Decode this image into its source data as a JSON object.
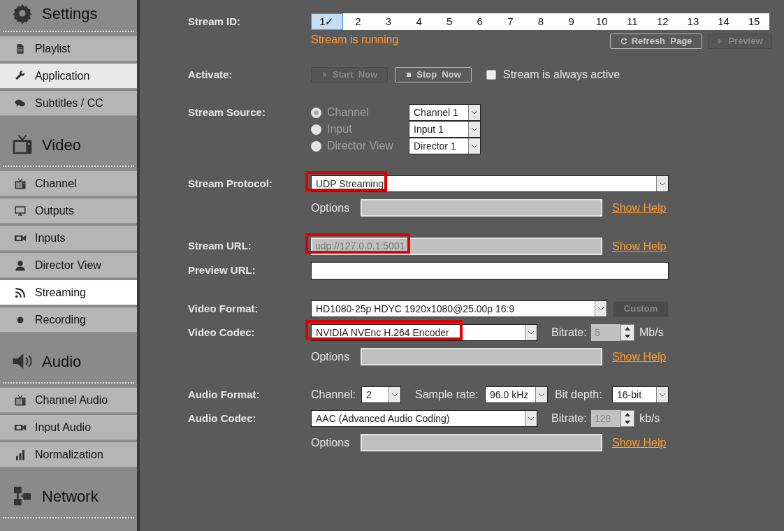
{
  "sidebar": {
    "sections": [
      {
        "title": "Settings",
        "kind": "gear",
        "items": [
          {
            "label": "Playlist",
            "kind": "document",
            "selected": false
          },
          {
            "label": "Application",
            "kind": "wrench",
            "selected": false,
            "hover": true
          },
          {
            "label": "Subtitles / CC",
            "kind": "speech",
            "selected": false
          }
        ]
      },
      {
        "title": "Video",
        "kind": "tv",
        "items": [
          {
            "label": "Channel",
            "kind": "tv",
            "selected": false
          },
          {
            "label": "Outputs",
            "kind": "monitor",
            "selected": false
          },
          {
            "label": "Inputs",
            "kind": "camera",
            "selected": false
          },
          {
            "label": "Director View",
            "kind": "person",
            "selected": false
          },
          {
            "label": "Streaming",
            "kind": "rss",
            "selected": true
          },
          {
            "label": "Recording",
            "kind": "dot",
            "selected": false
          }
        ]
      },
      {
        "title": "Audio",
        "kind": "speaker",
        "items": [
          {
            "label": "Channel Audio",
            "kind": "tv",
            "selected": false
          },
          {
            "label": "Input Audio",
            "kind": "camera",
            "selected": false
          },
          {
            "label": "Normalization",
            "kind": "bars",
            "selected": false
          }
        ]
      },
      {
        "title": "Network",
        "kind": "network"
      }
    ]
  },
  "stream_id": {
    "label": "Stream ID:",
    "ids": [
      {
        "label": "1✓",
        "selected": true
      },
      {
        "label": "2",
        "selected": false
      },
      {
        "label": "3",
        "selected": false
      },
      {
        "label": "4",
        "selected": false
      },
      {
        "label": "5",
        "selected": false
      },
      {
        "label": "6",
        "selected": false
      },
      {
        "label": "7",
        "selected": false
      },
      {
        "label": "8",
        "selected": false
      },
      {
        "label": "9",
        "selected": false
      },
      {
        "label": "10",
        "selected": false
      },
      {
        "label": "11",
        "selected": false
      },
      {
        "label": "12",
        "selected": false
      },
      {
        "label": "13",
        "selected": false
      },
      {
        "label": "14",
        "selected": false
      },
      {
        "label": "15",
        "selected": false
      }
    ],
    "status": "Stream is running"
  },
  "page_buttons": [
    {
      "label": "Refresh Page",
      "kind": "refresh",
      "disabled": false
    },
    {
      "label": "Preview",
      "kind": "play",
      "disabled": true
    }
  ],
  "activate": {
    "label": "Activate:",
    "buttons": [
      {
        "label": "Start Now",
        "kind": "play",
        "disabled": true
      },
      {
        "label": "Stop Now",
        "kind": "stop",
        "disabled": false
      }
    ],
    "always_active": {
      "label": "Stream is always active",
      "checked": false
    }
  },
  "stream_source": {
    "label": "Stream Source:",
    "disabled": true,
    "options": [
      {
        "label": "Channel",
        "selected": true,
        "value": "Channel 1"
      },
      {
        "label": "Input",
        "selected": false,
        "value": "Input 1"
      },
      {
        "label": "Director View",
        "selected": false,
        "value": "Director 1"
      }
    ]
  },
  "stream_protocol": {
    "label": "Stream Protocol:",
    "value": "UDP Streaming",
    "highlighted": true,
    "options_label": "Options",
    "help": "Show Help"
  },
  "stream_url": {
    "label": "Stream URL:",
    "value": "udp://127.0.0.1:5001",
    "highlighted": true,
    "help": "Show Help"
  },
  "preview_url": {
    "label": "Preview URL:"
  },
  "video_format": {
    "label": "Video Format:",
    "value": "HD1080-25p HDYC 1920x1080@25.00p 16:9",
    "button": "Custom"
  },
  "video_codec": {
    "label": "Video Codec:",
    "value": "NVIDIA NVEnc H.264 Encoder",
    "highlighted": true,
    "bitrate_label": "Bitrate:",
    "bitrate": "5",
    "unit": "Mb/s",
    "options_label": "Options",
    "help": "Show Help"
  },
  "audio_format": {
    "label": "Audio Format:",
    "channel_label": "Channel:",
    "channel": "2",
    "sample_rate_label": "Sample rate:",
    "sample_rate": "96.0 kHz",
    "bit_depth_label": "Bit depth:",
    "bit_depth": "16-bit"
  },
  "audio_codec": {
    "label": "Audio Codec:",
    "value": "AAC (Advanced Audio Coding)",
    "bitrate_label": "Bitrate:",
    "bitrate": "128",
    "unit": "kb/s",
    "options_label": "Options",
    "help": "Show Help"
  }
}
